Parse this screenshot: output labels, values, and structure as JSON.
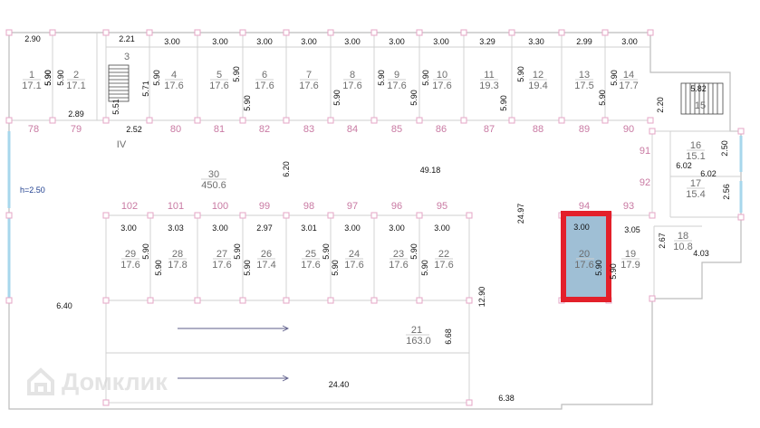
{
  "note_height": "h=2.50",
  "block_label": "IV",
  "watermark": "Домклик",
  "highlight": {
    "room": "20",
    "area": "17.6",
    "width": "3.00",
    "depth": "5.90"
  },
  "top_rooms": [
    {
      "num": "1",
      "area": "17.1",
      "width": "2.90",
      "depth": "5.90"
    },
    {
      "num": "2",
      "area": "17.1",
      "width": "",
      "depth": "5.90"
    },
    {
      "num": "3",
      "area": "",
      "width": "2.21",
      "depth": "5.71"
    },
    {
      "num": "4",
      "area": "17.6",
      "width": "3.00",
      "depth": "5.90"
    },
    {
      "num": "5",
      "area": "17.6",
      "width": "3.00",
      "depth": "5.90"
    },
    {
      "num": "6",
      "area": "17.6",
      "width": "3.00",
      "depth": "5.90"
    },
    {
      "num": "7",
      "area": "17.6",
      "width": "3.00",
      "depth": "5.90"
    },
    {
      "num": "8",
      "area": "17.6",
      "width": "3.00",
      "depth": "5.90"
    },
    {
      "num": "9",
      "area": "17.6",
      "width": "3.00",
      "depth": "5.90"
    },
    {
      "num": "10",
      "area": "17.6",
      "width": "3.00",
      "depth": "5.90"
    },
    {
      "num": "11",
      "area": "19.3",
      "width": "3.29",
      "depth": "5.90"
    },
    {
      "num": "12",
      "area": "19.4",
      "width": "3.30",
      "depth": "5.90"
    },
    {
      "num": "13",
      "area": "17.5",
      "width": "2.99",
      "depth": "5.90"
    },
    {
      "num": "14",
      "area": "17.7",
      "width": "3.00",
      "depth": "5.90"
    }
  ],
  "top_axes": [
    "78",
    "79",
    "80",
    "81",
    "82",
    "83",
    "84",
    "85",
    "86",
    "87",
    "88",
    "89",
    "90"
  ],
  "mid_axes": [
    "102",
    "101",
    "100",
    "99",
    "98",
    "97",
    "96",
    "95",
    "94",
    "93"
  ],
  "right_axes": [
    "91",
    "92"
  ],
  "bottom_rooms": [
    {
      "num": "29",
      "area": "17.6",
      "width": "3.00",
      "depth": "5.90"
    },
    {
      "num": "28",
      "area": "17.8",
      "width": "3.03",
      "depth": "5.90"
    },
    {
      "num": "27",
      "area": "17.6",
      "width": "3.00",
      "depth": "5.90"
    },
    {
      "num": "26",
      "area": "17.4",
      "width": "2.97",
      "depth": "5.90"
    },
    {
      "num": "25",
      "area": "17.6",
      "width": "3.01",
      "depth": "5.90"
    },
    {
      "num": "24",
      "area": "17.6",
      "width": "3.00",
      "depth": "5.90"
    },
    {
      "num": "23",
      "area": "17.6",
      "width": "3.00",
      "depth": "5.90"
    },
    {
      "num": "22",
      "area": "17.6",
      "width": "3.00",
      "depth": "5.90"
    }
  ],
  "room19": {
    "num": "19",
    "area": "17.9",
    "width": "3.05"
  },
  "room15": {
    "num": "15",
    "width": "5.82",
    "depth": "2.20"
  },
  "room16": {
    "num": "16",
    "area": "15.1",
    "width": "6.02",
    "depth": "2.50"
  },
  "room17": {
    "num": "17",
    "area": "15.4",
    "width": "6.02",
    "depth": "2.56"
  },
  "room18": {
    "num": "18",
    "area": "10.8",
    "width": "4.03",
    "depth": "2.67"
  },
  "room21": {
    "num": "21",
    "area": "163.0",
    "depth": "6.68"
  },
  "room30": {
    "num": "30",
    "area": "450.6"
  },
  "misc_dims": {
    "d_289": "2.89",
    "d_551": "5.51",
    "d_252": "2.52",
    "d_620": "6.20",
    "d_4918": "49.18",
    "d_2497": "24.97",
    "d_640": "6.40",
    "d_1290": "12.90",
    "d_2440": "24.40",
    "d_638": "6.38"
  }
}
